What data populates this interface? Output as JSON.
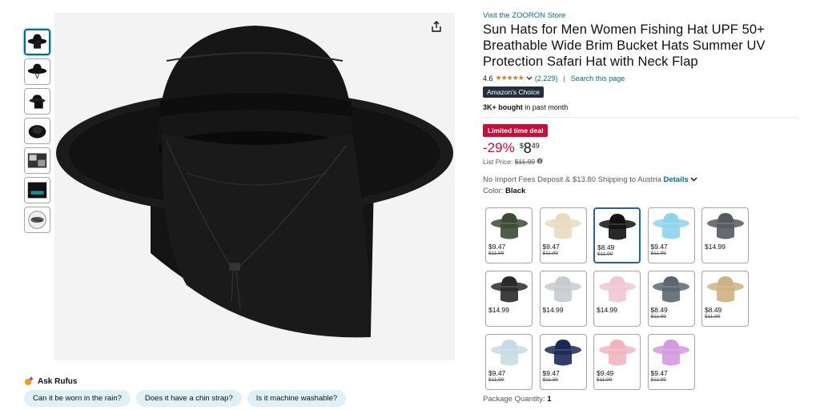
{
  "thumbnails": [
    {
      "name": "thumb-1",
      "active": true
    },
    {
      "name": "thumb-2",
      "active": false
    },
    {
      "name": "thumb-3",
      "active": false
    },
    {
      "name": "thumb-4",
      "active": false
    },
    {
      "name": "thumb-5",
      "active": false
    },
    {
      "name": "thumb-6",
      "active": false
    },
    {
      "name": "thumb-7",
      "active": false
    }
  ],
  "rufus": {
    "label": "Ask Rufus",
    "chips": [
      "Can it be worn in the rain?",
      "Does it have a chin strap?",
      "Is it machine washable?"
    ]
  },
  "product": {
    "store_link": "Visit the ZOORON Store",
    "title": "Sun Hats for Men Women Fishing Hat UPF 50+ Breathable Wide Brim Bucket Hats Summer UV Protection Safari Hat with Neck Flap",
    "rating": "4.6",
    "stars": "★★★★★",
    "rating_count": "(2,229)",
    "search_link": "Search this page",
    "badge": "Amazon's Choice",
    "bought_bold": "3K+ bought",
    "bought_rest": " in past month",
    "deal_badge": "Limited time deal",
    "discount": "-29%",
    "price_currency": "$",
    "price_whole": "8",
    "price_fraction": "49",
    "list_price_label": "List Price: ",
    "list_price": "$11.99",
    "import_text": "No Import Fees Deposit & $13.80 Shipping to Austria ",
    "details_link": "Details",
    "color_label": "Color: ",
    "color_value": "Black",
    "package_label": "Package Quantity: ",
    "package_value": "1"
  },
  "swatches": [
    {
      "price": "$9.47",
      "old": "$11.99",
      "color": "#3c4a35",
      "selected": false
    },
    {
      "price": "$9.47",
      "old": "$11.99",
      "color": "#e8dcc0",
      "selected": false
    },
    {
      "price": "$8.49",
      "old": "$11.99",
      "color": "#111111",
      "selected": true
    },
    {
      "price": "$9.47",
      "old": "$11.99",
      "color": "#8fd3ea",
      "selected": false
    },
    {
      "price": "$14.99",
      "old": "",
      "color": "#555a60",
      "selected": false
    },
    {
      "price": "$14.99",
      "old": "",
      "color": "#2a2a2a",
      "selected": false
    },
    {
      "price": "$14.99",
      "old": "",
      "color": "#c8ccd0",
      "selected": false
    },
    {
      "price": "$14.99",
      "old": "",
      "color": "#efc8d6",
      "selected": false
    },
    {
      "price": "$8.49",
      "old": "$11.99",
      "color": "#5d6670",
      "selected": false
    },
    {
      "price": "$8.49",
      "old": "$11.99",
      "color": "#cdb382",
      "selected": false
    },
    {
      "price": "$9.47",
      "old": "$11.99",
      "color": "#c8dbe4",
      "selected": false
    },
    {
      "price": "$9.47",
      "old": "$11.39",
      "color": "#1c2957",
      "selected": false
    },
    {
      "price": "$9.49",
      "old": "$11.99",
      "color": "#f2b5c0",
      "selected": false
    },
    {
      "price": "$9.47",
      "old": "$11.99",
      "color": "#d49adf",
      "selected": false
    }
  ],
  "colors": {
    "link": "#007185",
    "deal": "#cc0c39",
    "star": "#de7921",
    "selected_border": "#2162a1"
  }
}
